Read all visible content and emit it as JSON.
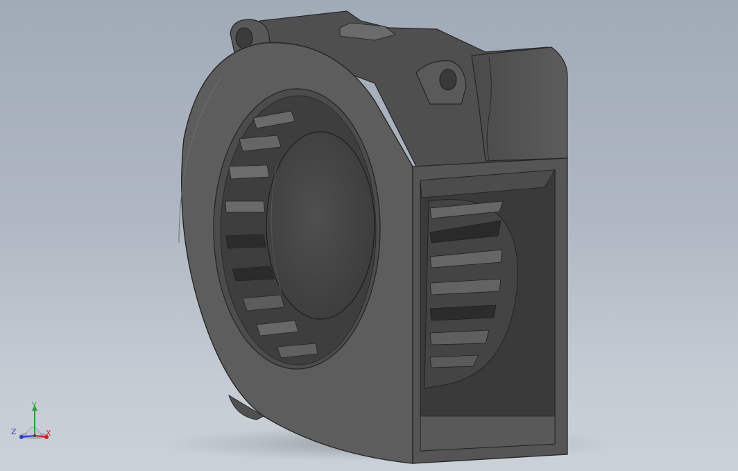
{
  "viewport": {
    "background_top": "#a1abb8",
    "background_bottom": "#cbd1d8",
    "model_color": "#5a5a5a"
  },
  "triad": {
    "x_label": "X",
    "y_label": "Y",
    "z_label": "Z",
    "x_color": "#c2261f",
    "y_color": "#2f9d3a",
    "z_color": "#2b3fc4"
  }
}
